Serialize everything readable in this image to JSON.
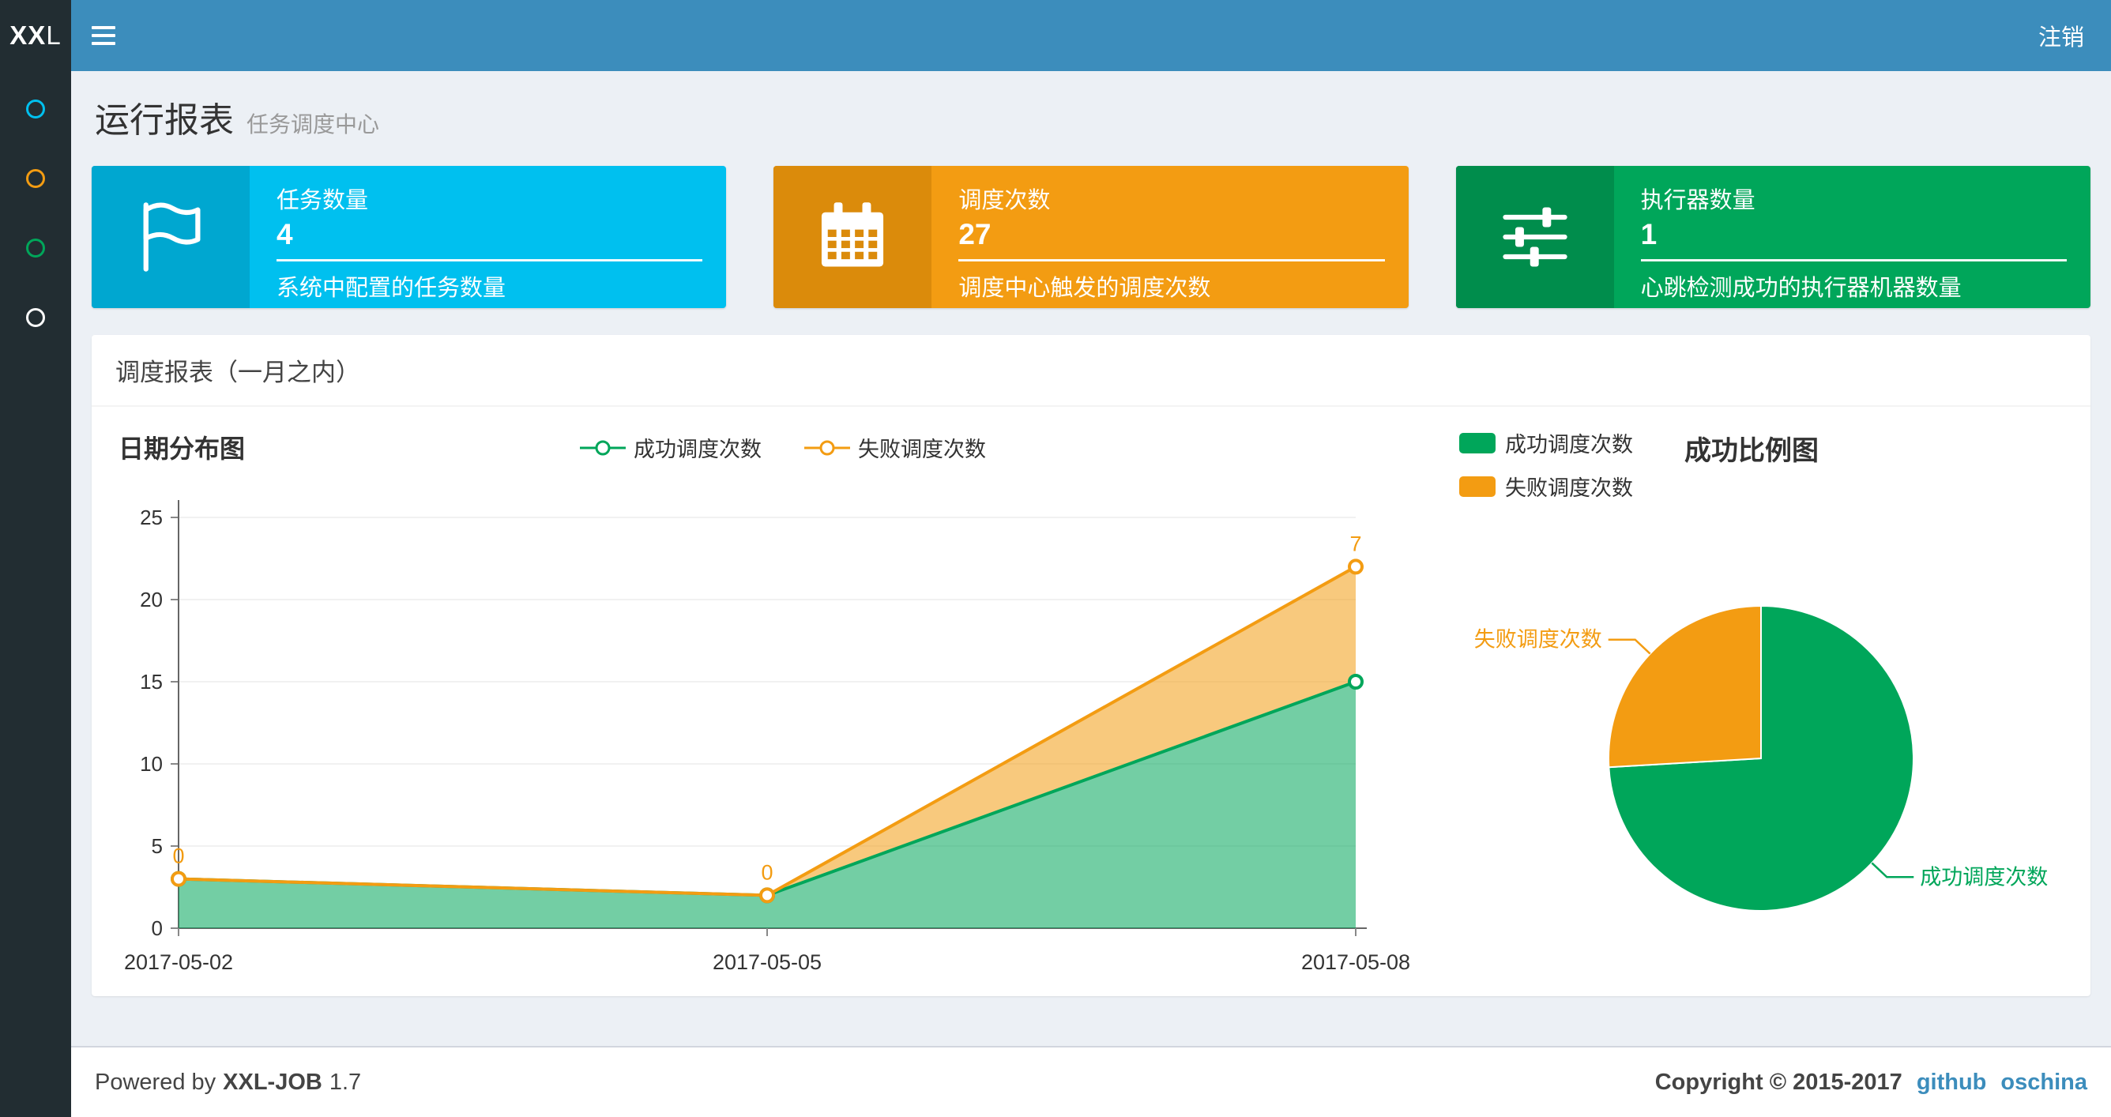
{
  "navbar": {
    "logo_bold": "XX",
    "logo_rest": "L",
    "logout_label": "注销",
    "bg_color": "#3c8dbc",
    "logo_bg_color": "#222d32"
  },
  "sidebar": {
    "bg_color": "#222d32",
    "items": [
      {
        "name": "dashboard",
        "icon": "circle",
        "color": "#00c0ef"
      },
      {
        "name": "job-manage",
        "icon": "circle",
        "color": "#f39c12"
      },
      {
        "name": "job-log",
        "icon": "circle",
        "color": "#00a65a"
      },
      {
        "name": "executor-manage",
        "icon": "circle",
        "color": "#ffffff"
      }
    ]
  },
  "page": {
    "title": "运行报表",
    "subtitle": "任务调度中心"
  },
  "info_boxes": [
    {
      "label": "任务数量",
      "value": "4",
      "desc": "系统中配置的任务数量",
      "bg": "#00c0ef",
      "icon_bg": "#00a7d0",
      "icon": "flag"
    },
    {
      "label": "调度次数",
      "value": "27",
      "desc": "调度中心触发的调度次数",
      "bg": "#f39c12",
      "icon_bg": "#db8b0b",
      "icon": "calendar"
    },
    {
      "label": "执行器数量",
      "value": "1",
      "desc": "心跳检测成功的执行器机器数量",
      "bg": "#00a65a",
      "icon_bg": "#008d4c",
      "icon": "sliders"
    }
  ],
  "panel": {
    "title": "调度报表（一月之内）"
  },
  "chart_data": [
    {
      "type": "area",
      "title": "日期分布图",
      "x": [
        "2017-05-02",
        "2017-05-05",
        "2017-05-08"
      ],
      "series": [
        {
          "name": "成功调度次数",
          "color": "#00a65a",
          "values": [
            3,
            2,
            15
          ]
        },
        {
          "name": "失败调度次数",
          "color": "#f39c12",
          "values": [
            0,
            0,
            7
          ],
          "point_labels": [
            "0",
            "0",
            "7"
          ]
        }
      ],
      "stacked": true,
      "ylim": [
        0,
        25
      ],
      "yticks": [
        0,
        5,
        10,
        15,
        20,
        25
      ],
      "legend_position": "top-center",
      "grid": "faint"
    },
    {
      "type": "pie",
      "title": "成功比例图",
      "slices": [
        {
          "name": "成功调度次数",
          "value": 20,
          "color": "#00a65a"
        },
        {
          "name": "失败调度次数",
          "value": 7,
          "color": "#f39c12"
        }
      ],
      "legend": [
        "成功调度次数",
        "失败调度次数"
      ],
      "legend_position": "top-left",
      "start_angle": 90,
      "clockwise": true
    }
  ],
  "footer": {
    "powered_prefix": "Powered by",
    "brand": "XXL-JOB",
    "version": "1.7",
    "copyright": "Copyright © 2015-2017",
    "links": [
      "github",
      "oschina"
    ]
  }
}
